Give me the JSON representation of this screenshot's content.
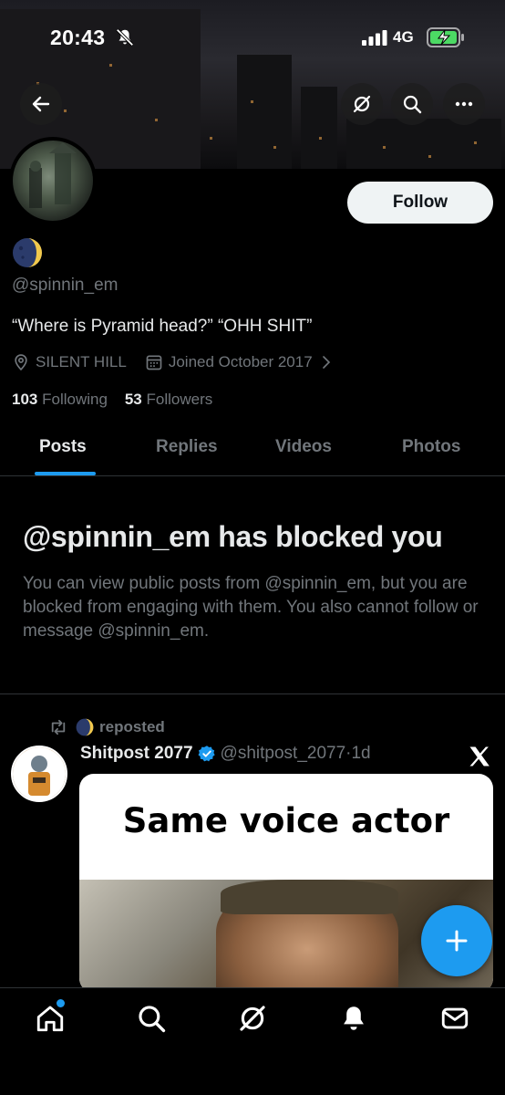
{
  "status_bar": {
    "time": "20:43",
    "carrier": "4G"
  },
  "profile": {
    "follow_label": "Follow",
    "handle": "@spinnin_em",
    "bio": "“Where is Pyramid head?” “OHH SHIT”",
    "location": "SILENT HILL",
    "joined": "Joined October 2017",
    "following_count": "103",
    "following_label": "Following",
    "followers_count": "53",
    "followers_label": "Followers"
  },
  "tabs": [
    {
      "label": "Posts",
      "active": true
    },
    {
      "label": "Replies",
      "active": false
    },
    {
      "label": "Videos",
      "active": false
    },
    {
      "label": "Photos",
      "active": false
    }
  ],
  "blocked": {
    "title": "@spinnin_em has blocked you",
    "description": "You can view public posts from @spinnin_em, but you are blocked from engaging with them. You also cannot follow or message @spinnin_em."
  },
  "post": {
    "repost_label": "reposted",
    "author_name": "Shitpost 2077",
    "author_handle": "@shitpost_2077",
    "time": "·1d",
    "media_text": "Same voice actor"
  },
  "colors": {
    "accent": "#1d9bf0",
    "muted": "#71767b",
    "text": "#e7e9ea"
  },
  "nav": {
    "items": [
      "home-icon",
      "search-icon",
      "grok-icon",
      "notifications-icon",
      "messages-icon"
    ]
  }
}
